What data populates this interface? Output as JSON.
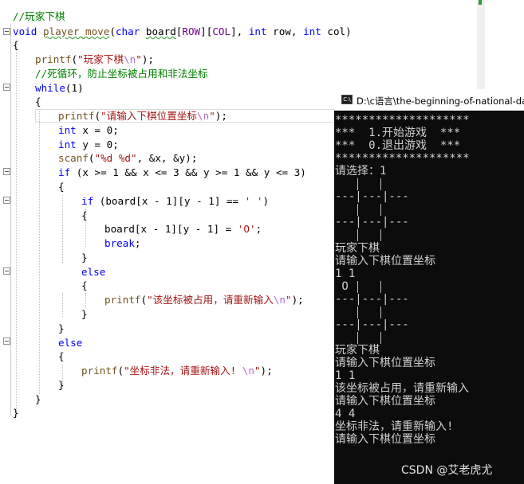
{
  "editor": {
    "lines": [
      [
        {
          "c": "cm",
          "t": "//玩家下棋"
        }
      ],
      [
        {
          "c": "kw",
          "t": "void"
        },
        {
          "c": "",
          "t": " "
        },
        {
          "c": "fn squig",
          "t": "player_move"
        },
        {
          "c": "",
          "t": "("
        },
        {
          "c": "kw",
          "t": "char"
        },
        {
          "c": "",
          "t": " "
        },
        {
          "c": "squig",
          "t": "board"
        },
        {
          "c": "",
          "t": "["
        },
        {
          "c": "mac",
          "t": "ROW"
        },
        {
          "c": "",
          "t": "]["
        },
        {
          "c": "mac",
          "t": "COL"
        },
        {
          "c": "",
          "t": "], "
        },
        {
          "c": "kw",
          "t": "int"
        },
        {
          "c": "",
          "t": " row, "
        },
        {
          "c": "kw",
          "t": "int"
        },
        {
          "c": "",
          "t": " col)"
        }
      ],
      [
        {
          "c": "",
          "t": "{"
        }
      ],
      [
        {
          "c": "fn",
          "t": "printf"
        },
        {
          "c": "",
          "t": "("
        },
        {
          "c": "st",
          "t": "\"玩家下棋"
        },
        {
          "c": "esc",
          "t": "\\n"
        },
        {
          "c": "st",
          "t": "\""
        },
        {
          "c": "",
          "t": ");"
        }
      ],
      [
        {
          "c": "cm",
          "t": "//死循环，防止坐标被占用和非法坐标"
        }
      ],
      [
        {
          "c": "kw",
          "t": "while"
        },
        {
          "c": "",
          "t": "(1)"
        }
      ],
      [
        {
          "c": "",
          "t": "{"
        }
      ],
      [
        {
          "c": "fn",
          "t": "printf"
        },
        {
          "c": "",
          "t": "("
        },
        {
          "c": "st",
          "t": "\"请输入下棋位置坐标"
        },
        {
          "c": "esc",
          "t": "\\n"
        },
        {
          "c": "st",
          "t": "\""
        },
        {
          "c": "",
          "t": ");"
        }
      ],
      [
        {
          "c": "kw",
          "t": "int"
        },
        {
          "c": "",
          "t": " x = 0;"
        }
      ],
      [
        {
          "c": "kw",
          "t": "int"
        },
        {
          "c": "",
          "t": " y = 0;"
        }
      ],
      [
        {
          "c": "fn",
          "t": "scanf"
        },
        {
          "c": "",
          "t": "("
        },
        {
          "c": "st",
          "t": "\"%d %d\""
        },
        {
          "c": "",
          "t": ", &x, &y);"
        }
      ],
      [
        {
          "c": "kw",
          "t": "if"
        },
        {
          "c": "",
          "t": " (x >= 1 && x <= 3 && y >= 1 && y <= 3)"
        }
      ],
      [
        {
          "c": "",
          "t": "{"
        }
      ],
      [
        {
          "c": "kw",
          "t": "if"
        },
        {
          "c": "",
          "t": " (board[x - 1][y - 1] == "
        },
        {
          "c": "st",
          "t": "' '"
        },
        {
          "c": "",
          "t": ")"
        }
      ],
      [
        {
          "c": "",
          "t": "{"
        }
      ],
      [
        {
          "c": "",
          "t": "board[x - 1][y - 1] = "
        },
        {
          "c": "st",
          "t": "'O'"
        },
        {
          "c": "",
          "t": ";"
        }
      ],
      [
        {
          "c": "kw",
          "t": "break"
        },
        {
          "c": "",
          "t": ";"
        }
      ],
      [
        {
          "c": "",
          "t": "}"
        }
      ],
      [
        {
          "c": "kw",
          "t": "else"
        }
      ],
      [
        {
          "c": "",
          "t": "{"
        }
      ],
      [
        {
          "c": "fn",
          "t": "printf"
        },
        {
          "c": "",
          "t": "("
        },
        {
          "c": "st",
          "t": "\"该坐标被占用，请重新输入"
        },
        {
          "c": "esc",
          "t": "\\n"
        },
        {
          "c": "st",
          "t": "\""
        },
        {
          "c": "",
          "t": ");"
        }
      ],
      [
        {
          "c": "",
          "t": "}"
        }
      ],
      [
        {
          "c": "",
          "t": "}"
        }
      ],
      [
        {
          "c": "kw",
          "t": "else"
        }
      ],
      [
        {
          "c": "",
          "t": "{"
        }
      ],
      [
        {
          "c": "fn",
          "t": "printf"
        },
        {
          "c": "",
          "t": "("
        },
        {
          "c": "st",
          "t": "\"坐标非法，请重新输入! "
        },
        {
          "c": "esc",
          "t": "\\n"
        },
        {
          "c": "st",
          "t": "\""
        },
        {
          "c": "",
          "t": ");"
        }
      ],
      [
        {
          "c": "",
          "t": "}"
        }
      ],
      [
        {
          "c": "",
          "t": "}"
        }
      ],
      [
        {
          "c": "",
          "t": "}"
        }
      ]
    ]
  },
  "console": {
    "title": "D:\\c语言\\the-beginning-of-national-day",
    "icon": "console-app-icon",
    "lines": [
      "********************",
      "***  1.开始游戏  ***",
      "***  0.退出游戏  ***",
      "********************",
      "请选择：1",
      "",
      "---|---|---",
      "",
      "---|---|---",
      "",
      "玩家下棋",
      "请输入下棋位置坐标",
      "1 1",
      " O ",
      "---|---|---",
      "",
      "---|---|---",
      "",
      "玩家下棋",
      "请输入下棋位置坐标",
      "1 1",
      "该坐标被占用，请重新输入",
      "请输入下棋位置坐标",
      "4 4",
      "坐标非法，请重新输入!",
      "请输入下棋位置坐标"
    ]
  },
  "watermark": "CSDN @艾老虎尤"
}
